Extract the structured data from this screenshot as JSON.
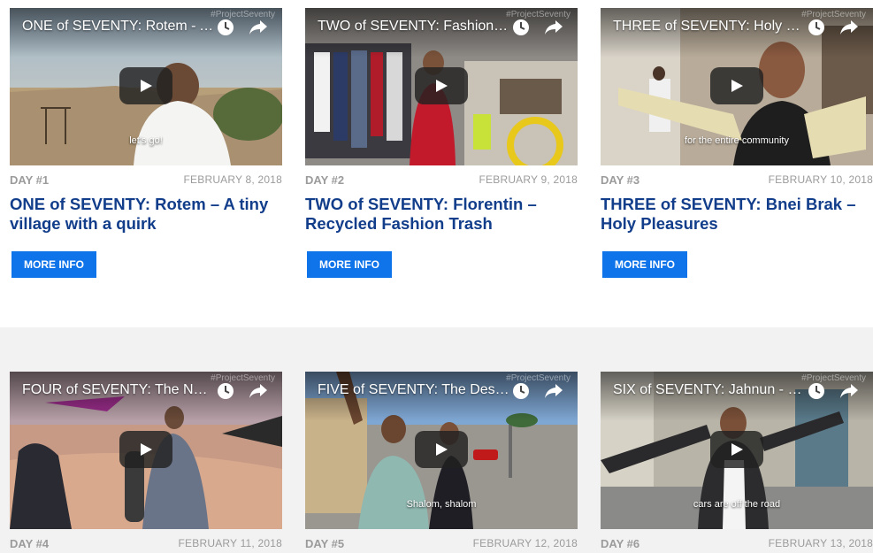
{
  "cards": [
    {
      "video_title": "ONE of SEVENTY: Rotem - A tiny village with a quirk",
      "watermark": "#ProjectSeventy",
      "caption": "let's go!",
      "day": "DAY #1",
      "date": "FEBRUARY 8, 2018",
      "title": "ONE of SEVENTY: Rotem – A tiny village with a quirk",
      "button": "MORE INFO"
    },
    {
      "video_title": "TWO of SEVENTY: Fashionable Trash",
      "watermark": "#ProjectSeventy",
      "caption": "",
      "day": "DAY #2",
      "date": "FEBRUARY 9, 2018",
      "title": "TWO of SEVENTY: Florentin  – Recycled Fashion Trash",
      "button": "MORE INFO"
    },
    {
      "video_title": "THREE of SEVENTY: Holy Pleasures",
      "watermark": "#ProjectSeventy",
      "caption": "for the entire community",
      "day": "DAY #3",
      "date": "FEBRUARY 10, 2018",
      "title": "THREE of SEVENTY: Bnei Brak – Holy Pleasures",
      "button": "MORE INFO"
    },
    {
      "video_title": "FOUR of SEVENTY: The Negev",
      "watermark": "#ProjectSeventy",
      "caption": "",
      "day": "DAY #4",
      "date": "FEBRUARY 11, 2018"
    },
    {
      "video_title": "FIVE of SEVENTY: The Desert",
      "watermark": "#ProjectSeventy",
      "caption": "Shalom, shalom",
      "day": "DAY #5",
      "date": "FEBRUARY 12, 2018"
    },
    {
      "video_title": "SIX of SEVENTY: Jahnun - Jaffa",
      "watermark": "#ProjectSeventy",
      "caption": "cars are off the road",
      "day": "DAY #6",
      "date": "FEBRUARY 13, 2018"
    }
  ],
  "colors": {
    "title_blue": "#113d8a",
    "button_blue": "#0f73ea",
    "meta_gray": "#9b9b9b",
    "row2_bg": "#f2f2f2"
  },
  "icons": [
    "clock-icon",
    "share-icon",
    "play-icon"
  ]
}
